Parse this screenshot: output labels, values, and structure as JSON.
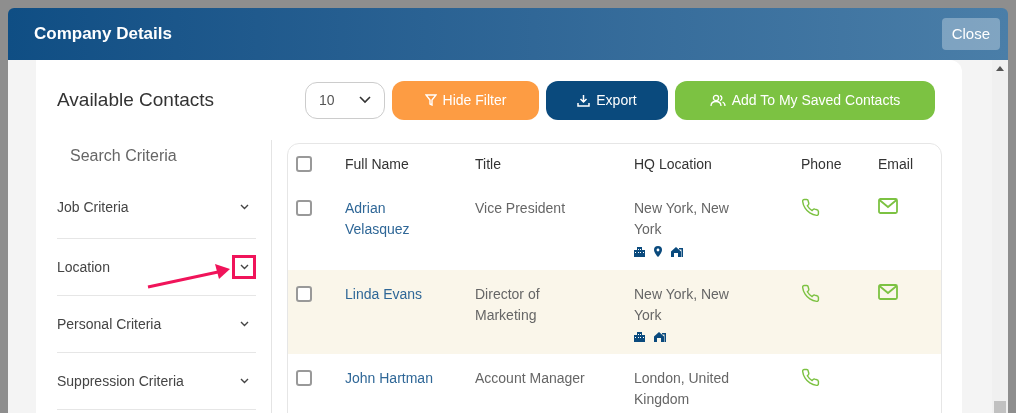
{
  "modal": {
    "title": "Company Details",
    "close_label": "Close"
  },
  "toolbar": {
    "heading": "Available Contacts",
    "page_size": "10",
    "buttons": [
      {
        "label": "Hide Filter",
        "kind": "filter"
      },
      {
        "label": "Export",
        "kind": "export"
      },
      {
        "label": "Add To My Saved Contacts",
        "kind": "add"
      }
    ]
  },
  "sidebar": {
    "title": "Search Criteria",
    "items": [
      {
        "label": "Job Criteria",
        "expanded": false,
        "annotated": false
      },
      {
        "label": "Location",
        "expanded": false,
        "annotated": true
      },
      {
        "label": "Personal Criteria",
        "expanded": false,
        "annotated": false
      },
      {
        "label": "Suppression Criteria",
        "expanded": false,
        "annotated": false
      }
    ]
  },
  "table": {
    "columns": [
      "Full Name",
      "Title",
      "HQ Location",
      "Phone",
      "Email"
    ],
    "header_checked": false,
    "rows": [
      {
        "name": "Adrian Velasquez",
        "title": "Vice President",
        "location": "New York, New York",
        "location_icons": [
          {
            "kind": "building"
          },
          {
            "kind": "pin"
          },
          {
            "kind": "home"
          }
        ],
        "phone": true,
        "email": true,
        "checked": false,
        "highlighted": false
      },
      {
        "name": "Linda Evans",
        "title": "Director of Marketing",
        "location": "New York, New York",
        "location_icons": [
          {
            "kind": "building"
          },
          {
            "kind": "home"
          }
        ],
        "phone": true,
        "email": true,
        "checked": false,
        "highlighted": true
      },
      {
        "name": "John Hartman",
        "title": "Account Manager",
        "location": "London, United Kingdom",
        "phone": true,
        "email": false,
        "checked": false,
        "highlighted": false
      }
    ]
  }
}
